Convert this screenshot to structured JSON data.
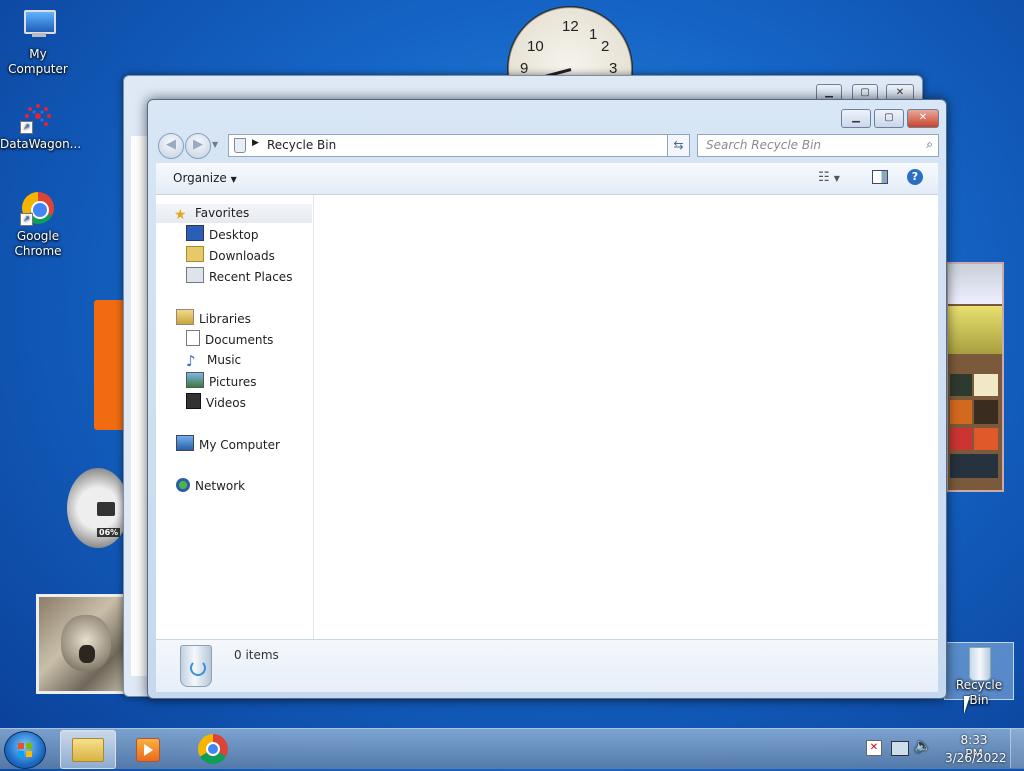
{
  "desktop": {
    "icons": [
      {
        "label": "My Computer",
        "icon": "computer-icon"
      },
      {
        "label": "DataWagon...",
        "icon": "datawagon-icon"
      },
      {
        "label": "Google Chrome",
        "icon": "chrome-icon"
      },
      {
        "label": "Recycle Bin",
        "icon": "recycle-bin-icon"
      }
    ],
    "clock_numbers": [
      "12",
      "1",
      "2",
      "3",
      "9",
      "10"
    ],
    "meter_value": "06%"
  },
  "window": {
    "title": "Recycle Bin",
    "address": "Recycle Bin",
    "search_placeholder": "Search Recycle Bin",
    "toolbar": {
      "organize": "Organize"
    },
    "nav": {
      "favorites": {
        "label": "Favorites",
        "items": [
          "Desktop",
          "Downloads",
          "Recent Places"
        ]
      },
      "libraries": {
        "label": "Libraries",
        "items": [
          "Documents",
          "Music",
          "Pictures",
          "Videos"
        ]
      },
      "computer": "My Computer",
      "network": "Network"
    },
    "details": {
      "count": "0 items"
    }
  },
  "taskbar": {
    "time": "8:33 PM",
    "date": "3/26/2022"
  },
  "colors": {
    "accent": "#1d6ec7",
    "window_frame": "#c5d8ee",
    "close": "#c7452c"
  }
}
